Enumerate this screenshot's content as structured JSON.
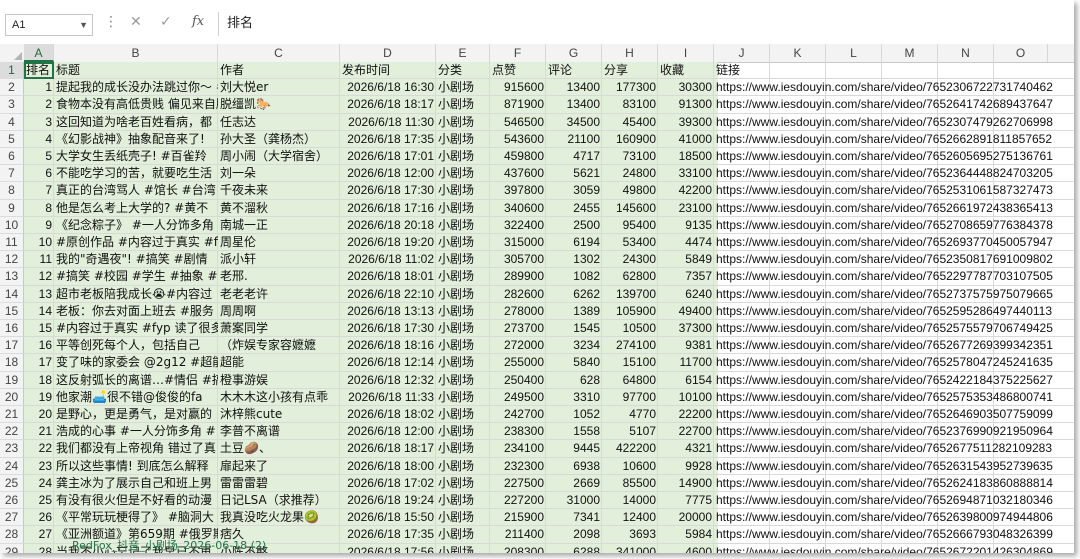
{
  "name_box": "A1",
  "formula_buttons": {
    "cancel": "✕",
    "enter": "✓",
    "fx": "fx"
  },
  "formula_content": "排名",
  "columns": [
    "A",
    "B",
    "C",
    "D",
    "E",
    "F",
    "G",
    "H",
    "I",
    "J",
    "K",
    "L",
    "M",
    "N",
    "O"
  ],
  "header": [
    "排名",
    "标题",
    "作者",
    "发布时间",
    "分类",
    "点赞",
    "评论",
    "分享",
    "收藏",
    "链接"
  ],
  "rows": [
    {
      "r": "1",
      "t": "提起我的成长没办法跳过你～ #",
      "a": "刘大悦er",
      "d": "2026/6/18 16:30",
      "c": "小剧场",
      "l": "915600",
      "cm": "13400",
      "s": "177300",
      "f": "30300",
      "u": "https://www.iesdouyin.com/share/video/7652306722731740462"
    },
    {
      "r": "2",
      "t": "食物本没有高低贵贱 偏见来自脱缰凯",
      "a": "脱缰凯🐎",
      "d": "2026/6/18 18:17",
      "c": "小剧场",
      "l": "871900",
      "cm": "13400",
      "s": "83100",
      "f": "91300",
      "u": "https://www.iesdouyin.com/share/video/7652641742689437647"
    },
    {
      "r": "3",
      "t": "这回知道为啥老百姓看病，都",
      "a": "任志达",
      "d": "2026/6/18 11:30",
      "c": "小剧场",
      "l": "546500",
      "cm": "34500",
      "s": "45400",
      "f": "39300",
      "u": "https://www.iesdouyin.com/share/video/7652307479262706998"
    },
    {
      "r": "4",
      "t": "《幻影战神》抽象配音来了!",
      "a": "孙大圣（龚杨杰）",
      "d": "2026/6/18 17:35",
      "c": "小剧场",
      "l": "543600",
      "cm": "21100",
      "s": "160900",
      "f": "41000",
      "u": "https://www.iesdouyin.com/share/video/7652662891811857652"
    },
    {
      "r": "5",
      "t": "大学女生丢纸壳子! #百雀羚",
      "a": "周小闹（大学宿舍）",
      "d": "2026/6/18 17:01",
      "c": "小剧场",
      "l": "459800",
      "cm": "4717",
      "s": "73100",
      "f": "18500",
      "u": "https://www.iesdouyin.com/share/video/7652605695275136761"
    },
    {
      "r": "6",
      "t": "不能吃学习的苦，就要吃生活",
      "a": "刘一朵",
      "d": "2026/6/18 12:00",
      "c": "小剧场",
      "l": "437600",
      "cm": "5621",
      "s": "24800",
      "f": "33100",
      "u": "https://www.iesdouyin.com/share/video/7652364448824703205"
    },
    {
      "r": "7",
      "t": "真正的台湾骂人 #馆长 #台湾",
      "a": "千夜未来",
      "d": "2026/6/18 17:30",
      "c": "小剧场",
      "l": "397800",
      "cm": "3059",
      "s": "49800",
      "f": "42200",
      "u": "https://www.iesdouyin.com/share/video/7652531061587327473"
    },
    {
      "r": "8",
      "t": "他是怎么考上大学的? #黄不",
      "a": "黄不溜秋",
      "d": "2026/6/18 17:16",
      "c": "小剧场",
      "l": "340600",
      "cm": "2455",
      "s": "145600",
      "f": "23100",
      "u": "https://www.iesdouyin.com/share/video/7652661972438365413"
    },
    {
      "r": "9",
      "t": "《纪念粽子》 #一人分饰多角",
      "a": "南城一正",
      "d": "2026/6/18 20:18",
      "c": "小剧场",
      "l": "322400",
      "cm": "2500",
      "s": "95400",
      "f": "9135",
      "u": "https://www.iesdouyin.com/share/video/7652708659776384378"
    },
    {
      "r": "10",
      "t": "#原创作品 #内容过于真实 #fy",
      "a": "周星伦",
      "d": "2026/6/18 19:20",
      "c": "小剧场",
      "l": "315000",
      "cm": "6194",
      "s": "53400",
      "f": "4474",
      "u": "https://www.iesdouyin.com/share/video/7652693770450057947"
    },
    {
      "r": "11",
      "t": "我的\"奇遇夜\"! #搞笑 #剧情",
      "a": "派小轩",
      "d": "2026/6/18 11:02",
      "c": "小剧场",
      "l": "305700",
      "cm": "1302",
      "s": "24300",
      "f": "5849",
      "u": "https://www.iesdouyin.com/share/video/7652350817691009802"
    },
    {
      "r": "12",
      "t": "#搞笑 #校园 #学生 #抽象 #沙",
      "a": "老邢.",
      "d": "2026/6/18 18:01",
      "c": "小剧场",
      "l": "289900",
      "cm": "1082",
      "s": "62800",
      "f": "7357",
      "u": "https://www.iesdouyin.com/share/video/7652297787703107505"
    },
    {
      "r": "13",
      "t": "超市老板陪我成长😭#内容过",
      "a": "老老老许",
      "d": "2026/6/18 22:10",
      "c": "小剧场",
      "l": "282600",
      "cm": "6262",
      "s": "139700",
      "f": "6240",
      "u": "https://www.iesdouyin.com/share/video/7652737575975079665"
    },
    {
      "r": "14",
      "t": "老板：你去对面上班去 #服务",
      "a": "周周啊",
      "d": "2026/6/18 13:13",
      "c": "小剧场",
      "l": "278000",
      "cm": "1389",
      "s": "105900",
      "f": "49400",
      "u": "https://www.iesdouyin.com/share/video/7652595286497440113"
    },
    {
      "r": "15",
      "t": "#内容过于真实 #fyp 读了很多",
      "a": "萧案同学",
      "d": "2026/6/18 17:30",
      "c": "小剧场",
      "l": "273700",
      "cm": "1545",
      "s": "10500",
      "f": "37300",
      "u": "https://www.iesdouyin.com/share/video/7652575579706749425"
    },
    {
      "r": "16",
      "t": "平等创死每个人，包括自己",
      "a": "（炸娱专家容嬷嬷",
      "d": "2026/6/18 18:16",
      "c": "小剧场",
      "l": "272000",
      "cm": "3234",
      "s": "274100",
      "f": "9381",
      "u": "https://www.iesdouyin.com/share/video/7652677269399342351"
    },
    {
      "r": "17",
      "t": "变了味的家委会 @2g12 #超能",
      "a": "超能",
      "d": "2026/6/18 12:14",
      "c": "小剧场",
      "l": "255000",
      "cm": "5840",
      "s": "15100",
      "f": "11700",
      "u": "https://www.iesdouyin.com/share/video/7652578047245241635"
    },
    {
      "r": "18",
      "t": "这反射弧长的离谱…#情侣 #搞",
      "a": "橙事游娱",
      "d": "2026/6/18 12:32",
      "c": "小剧场",
      "l": "250400",
      "cm": "628",
      "s": "64800",
      "f": "6154",
      "u": "https://www.iesdouyin.com/share/video/7652422184375225627"
    },
    {
      "r": "19",
      "t": "他家潮🛋️很不错@俊俊的fa",
      "a": "木木木这小孩有点乖",
      "d": "2026/6/18 11:33",
      "c": "小剧场",
      "l": "249500",
      "cm": "3310",
      "s": "97700",
      "f": "10100",
      "u": "https://www.iesdouyin.com/share/video/7652575353486800741"
    },
    {
      "r": "20",
      "t": "是野心，更是勇气，是对赢的",
      "a": "沐梓熊cute",
      "d": "2026/6/18 18:02",
      "c": "小剧场",
      "l": "242700",
      "cm": "1052",
      "s": "4770",
      "f": "22200",
      "u": "https://www.iesdouyin.com/share/video/7652646903507759099"
    },
    {
      "r": "21",
      "t": "浩成的心事 #一人分饰多角 #",
      "a": "李普不离谱",
      "d": "2026/6/18 12:00",
      "c": "小剧场",
      "l": "238300",
      "cm": "1558",
      "s": "5107",
      "f": "22700",
      "u": "https://www.iesdouyin.com/share/video/7652376990921950964"
    },
    {
      "r": "22",
      "t": "我们都没有上帝视角 错过了真",
      "a": "土豆🥔、",
      "d": "2026/6/18 18:17",
      "c": "小剧场",
      "l": "234100",
      "cm": "9445",
      "s": "422200",
      "f": "4321",
      "u": "https://www.iesdouyin.com/share/video/7652677511282109283"
    },
    {
      "r": "23",
      "t": "所以这些事情! 到底怎么解释",
      "a": "扉起来了",
      "d": "2026/6/18 18:00",
      "c": "小剧场",
      "l": "232300",
      "cm": "6938",
      "s": "10600",
      "f": "9928",
      "u": "https://www.iesdouyin.com/share/video/7652631543952739635"
    },
    {
      "r": "24",
      "t": "龚主冰为了展示自己和班上男",
      "a": "雷雷雷碧",
      "d": "2026/6/18 17:02",
      "c": "小剧场",
      "l": "227500",
      "cm": "2669",
      "s": "85500",
      "f": "14900",
      "u": "https://www.iesdouyin.com/share/video/7652624183860888814"
    },
    {
      "r": "25",
      "t": "有没有很火但是不好看的动漫",
      "a": "日记LSA（求推荐）",
      "d": "2026/6/18 19:24",
      "c": "小剧场",
      "l": "227200",
      "cm": "31000",
      "s": "14000",
      "f": "7775",
      "u": "https://www.iesdouyin.com/share/video/7652694871032180346"
    },
    {
      "r": "26",
      "t": "《平常玩玩梗得了》 #脑洞大",
      "a": "我真没吃火龙果🥝",
      "d": "2026/6/18 15:50",
      "c": "小剧场",
      "l": "215900",
      "cm": "7341",
      "s": "12400",
      "f": "20000",
      "u": "https://www.iesdouyin.com/share/video/7652639800974944806"
    },
    {
      "r": "27",
      "t": "《亚洲额道》第659期 #俄罗斯",
      "a": "痞久",
      "d": "2026/6/18 17:35",
      "c": "小剧场",
      "l": "211400",
      "cm": "2098",
      "s": "3693",
      "f": "5984",
      "u": "https://www.iesdouyin.com/share/video/7652666793048326399"
    },
    {
      "r": "28",
      "t": "当我不小心忘记了我早已不再",
      "a": "小陈不憨",
      "d": "2026/6/18 17:56",
      "c": "小剧场",
      "l": "208300",
      "cm": "6288",
      "s": "341000",
      "f": "4600",
      "u": "https://www.iesdouyin.com/share/video/7652672201426304869"
    },
    {
      "r": "29",
      "t": "我有我的原则 #战五啥#挑战",
      "a": "战五啥",
      "d": "2026/6/18 19:57",
      "c": "小剧场",
      "l": "189300",
      "cm": "1087",
      "s": "74300",
      "f": "6856",
      "u": "https://www.iesdouyin.com/share/video/7652690525983706383"
    }
  ],
  "sheet_tab": "RedFox_抖音_小剧场_2026-06-18 (2)"
}
